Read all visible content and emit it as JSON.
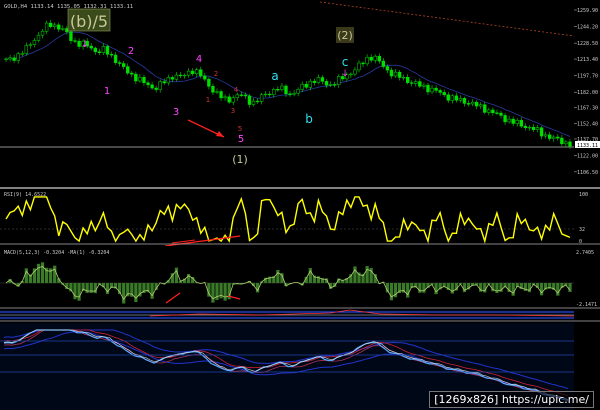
{
  "header": {
    "symbol_line": "GOLD,H4 1133.14 1135.05 1132.31 1133.11"
  },
  "wave_labels": {
    "b5": "(b)/5",
    "two_paren": "(2)",
    "one_paren": "(1)",
    "a": "a",
    "b": "b",
    "c": "c",
    "w1": "1",
    "w2": "2",
    "w3": "3",
    "w4": "4",
    "w5": "5",
    "s1": "1",
    "s2": "2",
    "s3": "3",
    "s4": "4",
    "s5": "5"
  },
  "price_axis": {
    "ticks": [
      "1259.90",
      "1244.20",
      "1228.50",
      "1213.40",
      "1197.70",
      "1182.00",
      "1167.30",
      "1152.40",
      "1137.70",
      "1122.00",
      "1106.50",
      "1091.20"
    ],
    "current": "1133.11"
  },
  "rsi": {
    "label": "RSI(9) 14.6522",
    "ticks": [
      "100",
      "32",
      "0"
    ]
  },
  "macd": {
    "label": "MACD(5,12,3) -0.3204 -MA(1) -0.3204",
    "ticks": [
      "2.7405",
      "-2.1471"
    ]
  },
  "watermark": "[1269x826] https://upic.me/",
  "colors": {
    "candles": "#00e000",
    "rsi": "#ffff00",
    "macd_hist": "#3a7a28",
    "macd_line": "#b0d070",
    "magenta": "#ff44ff",
    "cyan": "#33ddee",
    "arrow": "#ff2020",
    "maroon_label": "#cc3333",
    "box_label": "#c8c898"
  },
  "chart_data": {
    "type": "line",
    "title": "GOLD,H4",
    "series": [
      {
        "name": "GOLD,H4",
        "values": [
          1212,
          1214,
          1218,
          1222,
          1230,
          1236,
          1243,
          1247,
          1244,
          1240,
          1233,
          1228,
          1227,
          1225,
          1220,
          1222,
          1218,
          1212,
          1205,
          1200,
          1196,
          1192,
          1188,
          1186,
          1190,
          1194,
          1199,
          1196,
          1200,
          1204,
          1198,
          1190,
          1184,
          1178,
          1174,
          1177,
          1180,
          1176,
          1172,
          1175,
          1180,
          1183,
          1186,
          1183,
          1180,
          1184,
          1188,
          1192,
          1194,
          1191,
          1189,
          1192,
          1196,
          1200,
          1204,
          1210,
          1216,
          1214,
          1208,
          1202,
          1198,
          1196,
          1193,
          1190,
          1188,
          1186,
          1184,
          1181,
          1178,
          1176,
          1174,
          1173,
          1171,
          1168,
          1166,
          1163,
          1160,
          1157,
          1154,
          1152,
          1150,
          1148,
          1145,
          1142,
          1139,
          1137,
          1135,
          1133
        ]
      }
    ],
    "ylim": [
      1091.2,
      1259.9
    ]
  }
}
